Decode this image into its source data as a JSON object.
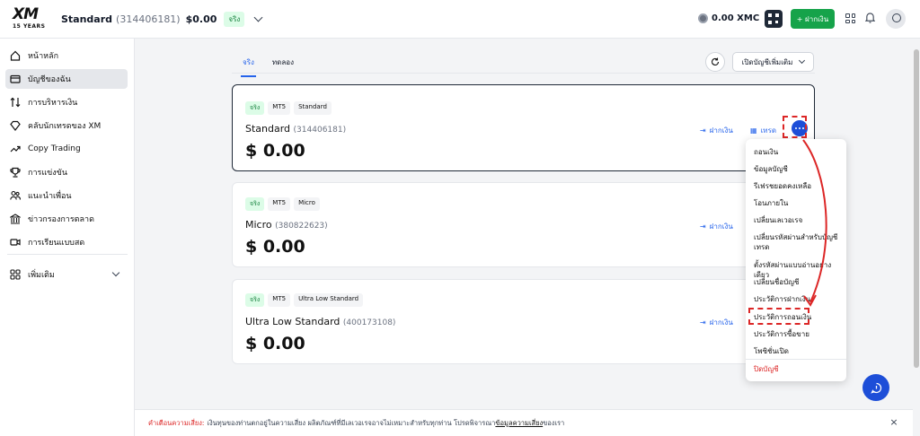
{
  "header": {
    "logo_text": "XM",
    "logo_subtext": "15 YEARS",
    "account_name": "Standard",
    "account_number": "(314406181)",
    "balance": "$0.00",
    "account_badge": "จริง",
    "xmc_balance": "0.00 XMC",
    "deposit_button": "+ ฝากเงิน"
  },
  "sidebar": {
    "items": [
      {
        "label": "หน้าหลัก",
        "icon": "home-icon"
      },
      {
        "label": "บัญชีของฉัน",
        "icon": "wallet-icon"
      },
      {
        "label": "การบริหารเงิน",
        "icon": "transfer-icon"
      },
      {
        "label": "คลับนักเทรดของ XM",
        "icon": "diamond-icon"
      },
      {
        "label": "Copy Trading",
        "icon": "trend-icon"
      },
      {
        "label": "การแข่งขัน",
        "icon": "trophy-icon"
      },
      {
        "label": "แนะนำเพื่อน",
        "icon": "friends-icon"
      },
      {
        "label": "ข่าวกรองการตลาด",
        "icon": "building-icon"
      },
      {
        "label": "การเรียนแบบสด",
        "icon": "video-icon"
      },
      {
        "label": "เพิ่มเติม",
        "icon": "more-grid-icon"
      }
    ]
  },
  "main": {
    "tabs": [
      "จริง",
      "ทดลอง"
    ],
    "open_account_button": "เปิดบัญชีเพิ่มเติม",
    "deposit_action": "ฝากเงิน",
    "trade_action": "เทรด",
    "accounts": [
      {
        "chips": [
          "จริง",
          "MT5",
          "Standard"
        ],
        "name": "Standard",
        "number": "(314406181)",
        "balance": "$ 0.00"
      },
      {
        "chips": [
          "จริง",
          "MT5",
          "Micro"
        ],
        "name": "Micro",
        "number": "(380822623)",
        "balance": "$ 0.00"
      },
      {
        "chips": [
          "จริง",
          "MT5",
          "Ultra Low Standard"
        ],
        "name": "Ultra Low Standard",
        "number": "(400173108)",
        "balance": "$ 0.00"
      }
    ]
  },
  "dropdown": {
    "items": [
      "ถอนเงิน",
      "ข้อมูลบัญชี",
      "รีเฟรชยอดคงเหลือ",
      "โอนภายใน",
      "เปลี่ยนเลเวอเรจ",
      "เปลี่ยนรหัสผ่านสำหรับบัญชีเทรด",
      "ตั้งรหัสผ่านแบบอ่านอย่างเดียว",
      "เปลี่ยนชื่อบัญชี",
      "ประวัติการฝากเงิน",
      "ประวัติการถอนเงิน",
      "ประวัติการซื้อขาย",
      "โพซิชั่นเปิด"
    ],
    "close_account": "ปิดบัญชี"
  },
  "footer": {
    "warning_label": "คำเตือนความเสี่ยง:",
    "warning_text": "เงินทุนของท่านตกอยู่ในความเสี่ยง ผลิตภัณฑ์ที่มีเลเวอเรจอาจไม่เหมาะสำหรับทุกท่าน โปรดพิจารณา",
    "link_text": "ข้อมูลความเสี่ยง",
    "suffix": "ของเรา",
    "close": "×"
  },
  "colors": {
    "primary": "#1d4ed8",
    "deposit_green": "#16a34a",
    "highlight_red": "#dc2626"
  }
}
